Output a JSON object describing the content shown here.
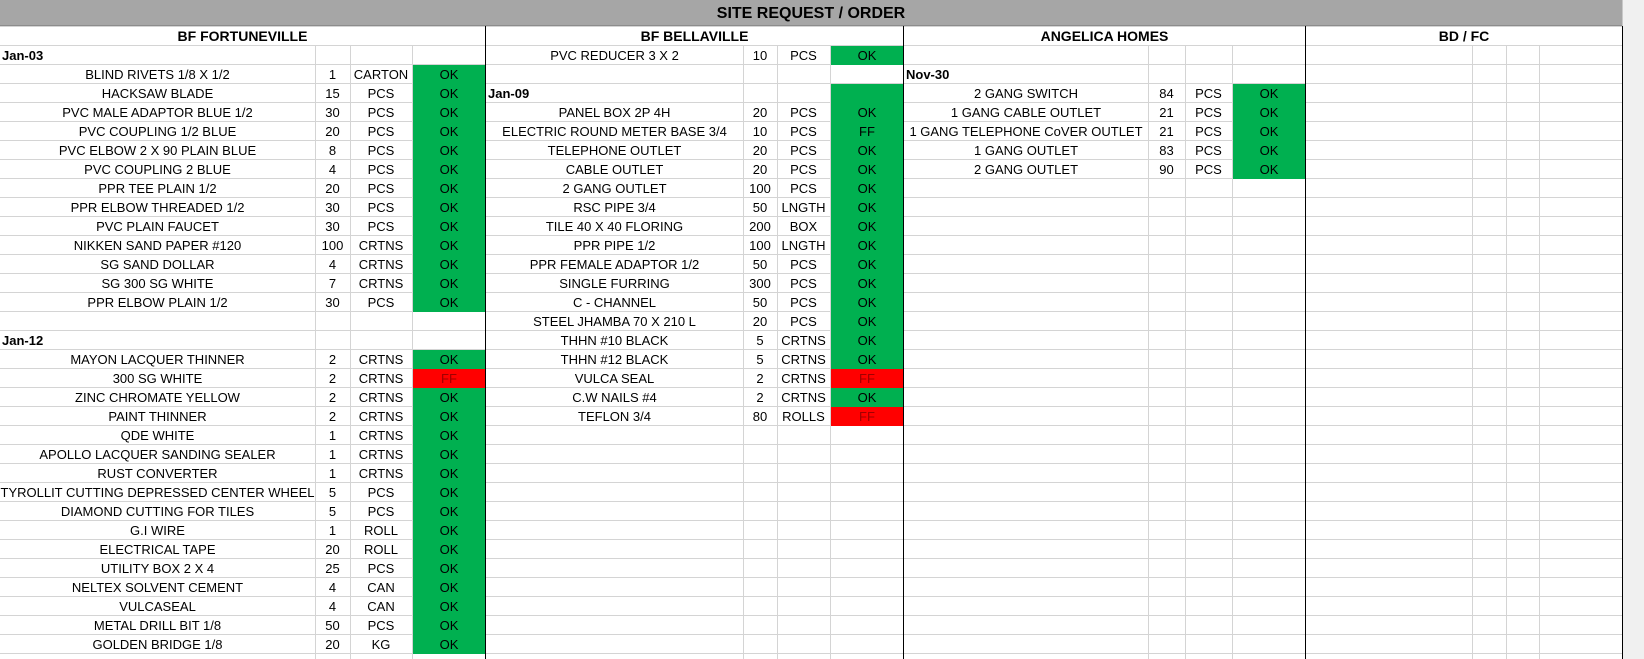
{
  "title": "SITE REQUEST / ORDER",
  "colors": {
    "ok": "#00b050",
    "ff": "#ff0000",
    "title_bar": "#a6a6a6"
  },
  "sections": [
    {
      "name": "BF FORTUNEVILLE",
      "rows": [
        {
          "date": "Jan-03"
        },
        {
          "item": "BLIND RIVETS 1/8 X 1/2",
          "qty": "1",
          "unit": "CARTON",
          "status": "OK"
        },
        {
          "item": "HACKSAW BLADE",
          "qty": "15",
          "unit": "PCS",
          "status": "OK"
        },
        {
          "item": "PVC MALE ADAPTOR BLUE 1/2",
          "qty": "30",
          "unit": "PCS",
          "status": "OK"
        },
        {
          "item": "PVC COUPLING 1/2 BLUE",
          "qty": "20",
          "unit": "PCS",
          "status": "OK"
        },
        {
          "item": "PVC ELBOW 2 X 90 PLAIN BLUE",
          "qty": "8",
          "unit": "PCS",
          "status": "OK"
        },
        {
          "item": "PVC COUPLING 2 BLUE",
          "qty": "4",
          "unit": "PCS",
          "status": "OK"
        },
        {
          "item": "PPR TEE PLAIN 1/2",
          "qty": "20",
          "unit": "PCS",
          "status": "OK"
        },
        {
          "item": "PPR ELBOW THREADED 1/2",
          "qty": "30",
          "unit": "PCS",
          "status": "OK"
        },
        {
          "item": "PVC PLAIN FAUCET",
          "qty": "30",
          "unit": "PCS",
          "status": "OK"
        },
        {
          "item": "NIKKEN SAND PAPER #120",
          "qty": "100",
          "unit": "CRTNS",
          "status": "OK"
        },
        {
          "item": "SG SAND DOLLAR",
          "qty": "4",
          "unit": "CRTNS",
          "status": "OK"
        },
        {
          "item": "SG 300 SG WHITE",
          "qty": "7",
          "unit": "CRTNS",
          "status": "OK"
        },
        {
          "item": "PPR ELBOW PLAIN 1/2",
          "qty": "30",
          "unit": "PCS",
          "status": "OK"
        },
        {},
        {
          "date": "Jan-12"
        },
        {
          "item": "MAYON LACQUER THINNER",
          "qty": "2",
          "unit": "CRTNS",
          "status": "OK"
        },
        {
          "item": "300 SG WHITE",
          "qty": "2",
          "unit": "CRTNS",
          "status": "FF"
        },
        {
          "item": "ZINC CHROMATE YELLOW",
          "qty": "2",
          "unit": "CRTNS",
          "status": "OK"
        },
        {
          "item": "PAINT THINNER",
          "qty": "2",
          "unit": "CRTNS",
          "status": "OK"
        },
        {
          "item": "QDE WHITE",
          "qty": "1",
          "unit": "CRTNS",
          "status": "OK"
        },
        {
          "item": "APOLLO LACQUER SANDING SEALER",
          "qty": "1",
          "unit": "CRTNS",
          "status": "OK"
        },
        {
          "item": "RUST CONVERTER",
          "qty": "1",
          "unit": "CRTNS",
          "status": "OK"
        },
        {
          "item": "TYROLLIT CUTTING DEPRESSED CENTER WHEEL",
          "qty": "5",
          "unit": "PCS",
          "status": "OK"
        },
        {
          "item": "DIAMOND CUTTING FOR TILES",
          "qty": "5",
          "unit": "PCS",
          "status": "OK"
        },
        {
          "item": "G.I WIRE",
          "qty": "1",
          "unit": "ROLL",
          "status": "OK"
        },
        {
          "item": "ELECTRICAL TAPE",
          "qty": "20",
          "unit": "ROLL",
          "status": "OK"
        },
        {
          "item": "UTILITY BOX 2 X 4",
          "qty": "25",
          "unit": "PCS",
          "status": "OK"
        },
        {
          "item": "NELTEX SOLVENT CEMENT",
          "qty": "4",
          "unit": "CAN",
          "status": "OK"
        },
        {
          "item": "VULCASEAL",
          "qty": "4",
          "unit": "CAN",
          "status": "OK"
        },
        {
          "item": "METAL DRILL BIT 1/8",
          "qty": "50",
          "unit": "PCS",
          "status": "OK"
        },
        {
          "item": "GOLDEN BRIDGE 1/8",
          "qty": "20",
          "unit": "KG",
          "status": "OK"
        }
      ]
    },
    {
      "name": "BF BELLAVILLE",
      "rows": [
        {
          "item": "PVC REDUCER 3 X 2",
          "qty": "10",
          "unit": "PCS",
          "status": "OK"
        },
        {},
        {
          "date": "Jan-09",
          "fill": true
        },
        {
          "item": "PANEL BOX 2P 4H",
          "qty": "20",
          "unit": "PCS",
          "status": "OK"
        },
        {
          "item": "ELECTRIC ROUND METER BASE 3/4",
          "qty": "10",
          "unit": "PCS",
          "status": "FF",
          "status_color": "ok"
        },
        {
          "item": "TELEPHONE OUTLET",
          "qty": "20",
          "unit": "PCS",
          "status": "OK"
        },
        {
          "item": "CABLE OUTLET",
          "qty": "20",
          "unit": "PCS",
          "status": "OK"
        },
        {
          "item": "2 GANG OUTLET",
          "qty": "100",
          "unit": "PCS",
          "status": "OK"
        },
        {
          "item": "RSC PIPE 3/4",
          "qty": "50",
          "unit": "LNGTH",
          "status": "OK"
        },
        {
          "item": "TILE 40 X 40 FLORING",
          "qty": "200",
          "unit": "BOX",
          "status": "OK"
        },
        {
          "item": "PPR PIPE 1/2",
          "qty": "100",
          "unit": "LNGTH",
          "status": "OK"
        },
        {
          "item": "PPR FEMALE ADAPTOR 1/2",
          "qty": "50",
          "unit": "PCS",
          "status": "OK"
        },
        {
          "item": "SINGLE FURRING",
          "qty": "300",
          "unit": "PCS",
          "status": "OK"
        },
        {
          "item": "C - CHANNEL",
          "qty": "50",
          "unit": "PCS",
          "status": "OK"
        },
        {
          "item": "STEEL JHAMBA 70 X 210 L",
          "qty": "20",
          "unit": "PCS",
          "status": "OK"
        },
        {
          "item": "THHN #10 BLACK",
          "qty": "5",
          "unit": "CRTNS",
          "status": "OK"
        },
        {
          "item": "THHN #12 BLACK",
          "qty": "5",
          "unit": "CRTNS",
          "status": "OK"
        },
        {
          "item": "VULCA SEAL",
          "qty": "2",
          "unit": "CRTNS",
          "status": "FF"
        },
        {
          "item": "C.W NAILS #4",
          "qty": "2",
          "unit": "CRTNS",
          "status": "OK"
        },
        {
          "item": "TEFLON 3/4",
          "qty": "80",
          "unit": "ROLLS",
          "status": "FF"
        }
      ]
    },
    {
      "name": "ANGELICA HOMES",
      "rows": [
        {},
        {
          "date": "Nov-30"
        },
        {
          "item": "2 GANG SWITCH",
          "qty": "84",
          "unit": "PCS",
          "status": "OK"
        },
        {
          "item": "1 GANG CABLE OUTLET",
          "qty": "21",
          "unit": "PCS",
          "status": "OK"
        },
        {
          "item": "1 GANG TELEPHONE CoVER OUTLET",
          "qty": "21",
          "unit": "PCS",
          "status": "OK"
        },
        {
          "item": "1 GANG OUTLET",
          "qty": "83",
          "unit": "PCS",
          "status": "OK"
        },
        {
          "item": "2 GANG OUTLET",
          "qty": "90",
          "unit": "PCS",
          "status": "OK"
        }
      ]
    },
    {
      "name": "BD / FC",
      "rows": []
    }
  ]
}
